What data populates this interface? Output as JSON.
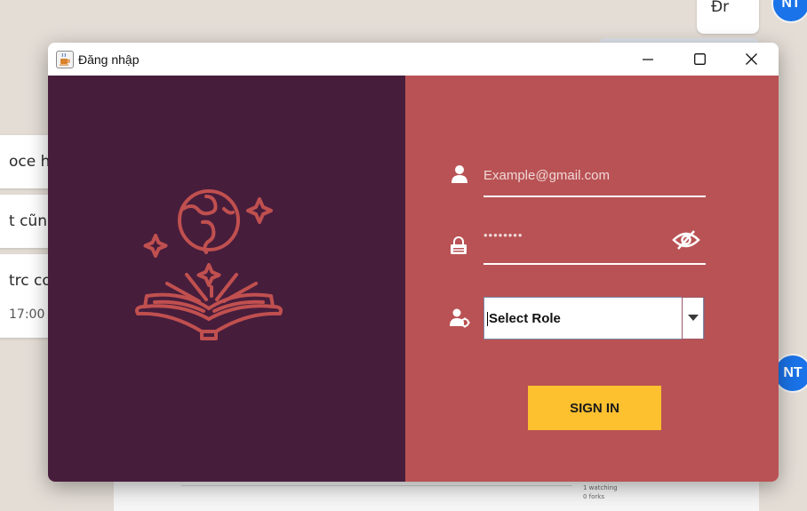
{
  "background": {
    "bubbles": [
      {
        "text": "oce h"
      },
      {
        "text": "t cũn"
      },
      {
        "text": "trc co",
        "time": "17:00"
      }
    ],
    "top_bubble": "Đr",
    "avatar_initials": "NT",
    "footer_lines": [
      "1 watching",
      "0 forks"
    ]
  },
  "window": {
    "title": "Đăng nhập",
    "controls": {
      "minimize": "minimize-icon",
      "maximize": "maximize-icon",
      "close": "close-icon"
    }
  },
  "login": {
    "email_placeholder": "Example@gmail.com",
    "email_value": "",
    "password_mask": "••••••••",
    "role_selected": "Select Role",
    "signin_label": "SIGN IN"
  },
  "colors": {
    "left_panel": "#471d3c",
    "right_panel": "#b95254",
    "illustration": "#c0504f",
    "signin_button": "#fdc02f"
  },
  "icons": {
    "illustration": "book-globe-illustration",
    "email": "user-icon",
    "password": "lock-icon",
    "toggle_password": "eye-slash-icon",
    "role": "user-gear-icon",
    "dropdown": "caret-down-icon"
  }
}
